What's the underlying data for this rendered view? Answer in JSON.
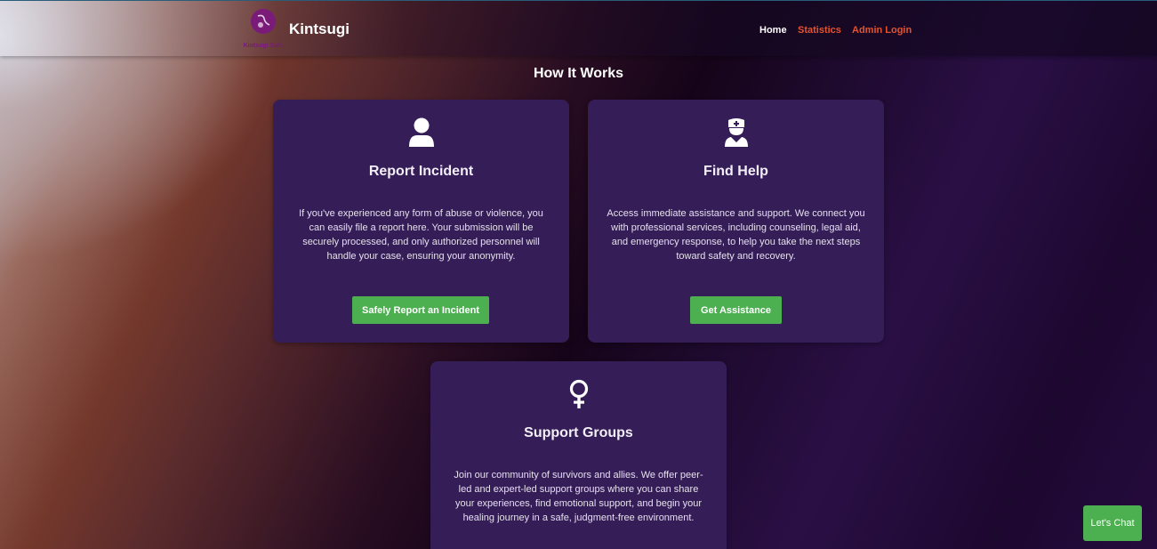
{
  "header": {
    "logo_text": "Kintsugi Safe",
    "brand": "Kintsugi",
    "nav": {
      "home": "Home",
      "statistics": "Statistics",
      "admin_login": "Admin Login"
    }
  },
  "main": {
    "section_title": "How It Works",
    "cards": [
      {
        "icon": "user-icon",
        "title": "Report Incident",
        "description": "If you've experienced any form of abuse or violence, you can easily file a report here. Your submission will be securely processed, and only authorized personnel will handle your case, ensuring your anonymity.",
        "button": "Safely Report an Incident"
      },
      {
        "icon": "user-nurse-icon",
        "title": "Find Help",
        "description": "Access immediate assistance and support. We connect you with professional services, including counseling, legal aid, and emergency response, to help you take the next steps toward safety and recovery.",
        "button": "Get Assistance"
      },
      {
        "icon": "venus-icon",
        "title": "Support Groups",
        "description": "Join our community of survivors and allies. We offer peer-led and expert-led support groups where you can share your experiences, find emotional support, and begin your healing journey in a safe, judgment-free environment."
      }
    ]
  },
  "chat": {
    "label": "Let's Chat"
  },
  "colors": {
    "accent_green": "#4caf50",
    "nav_link": "#e4532e",
    "card_bg": "#351d57",
    "logo_purple": "#7a1b7a"
  }
}
